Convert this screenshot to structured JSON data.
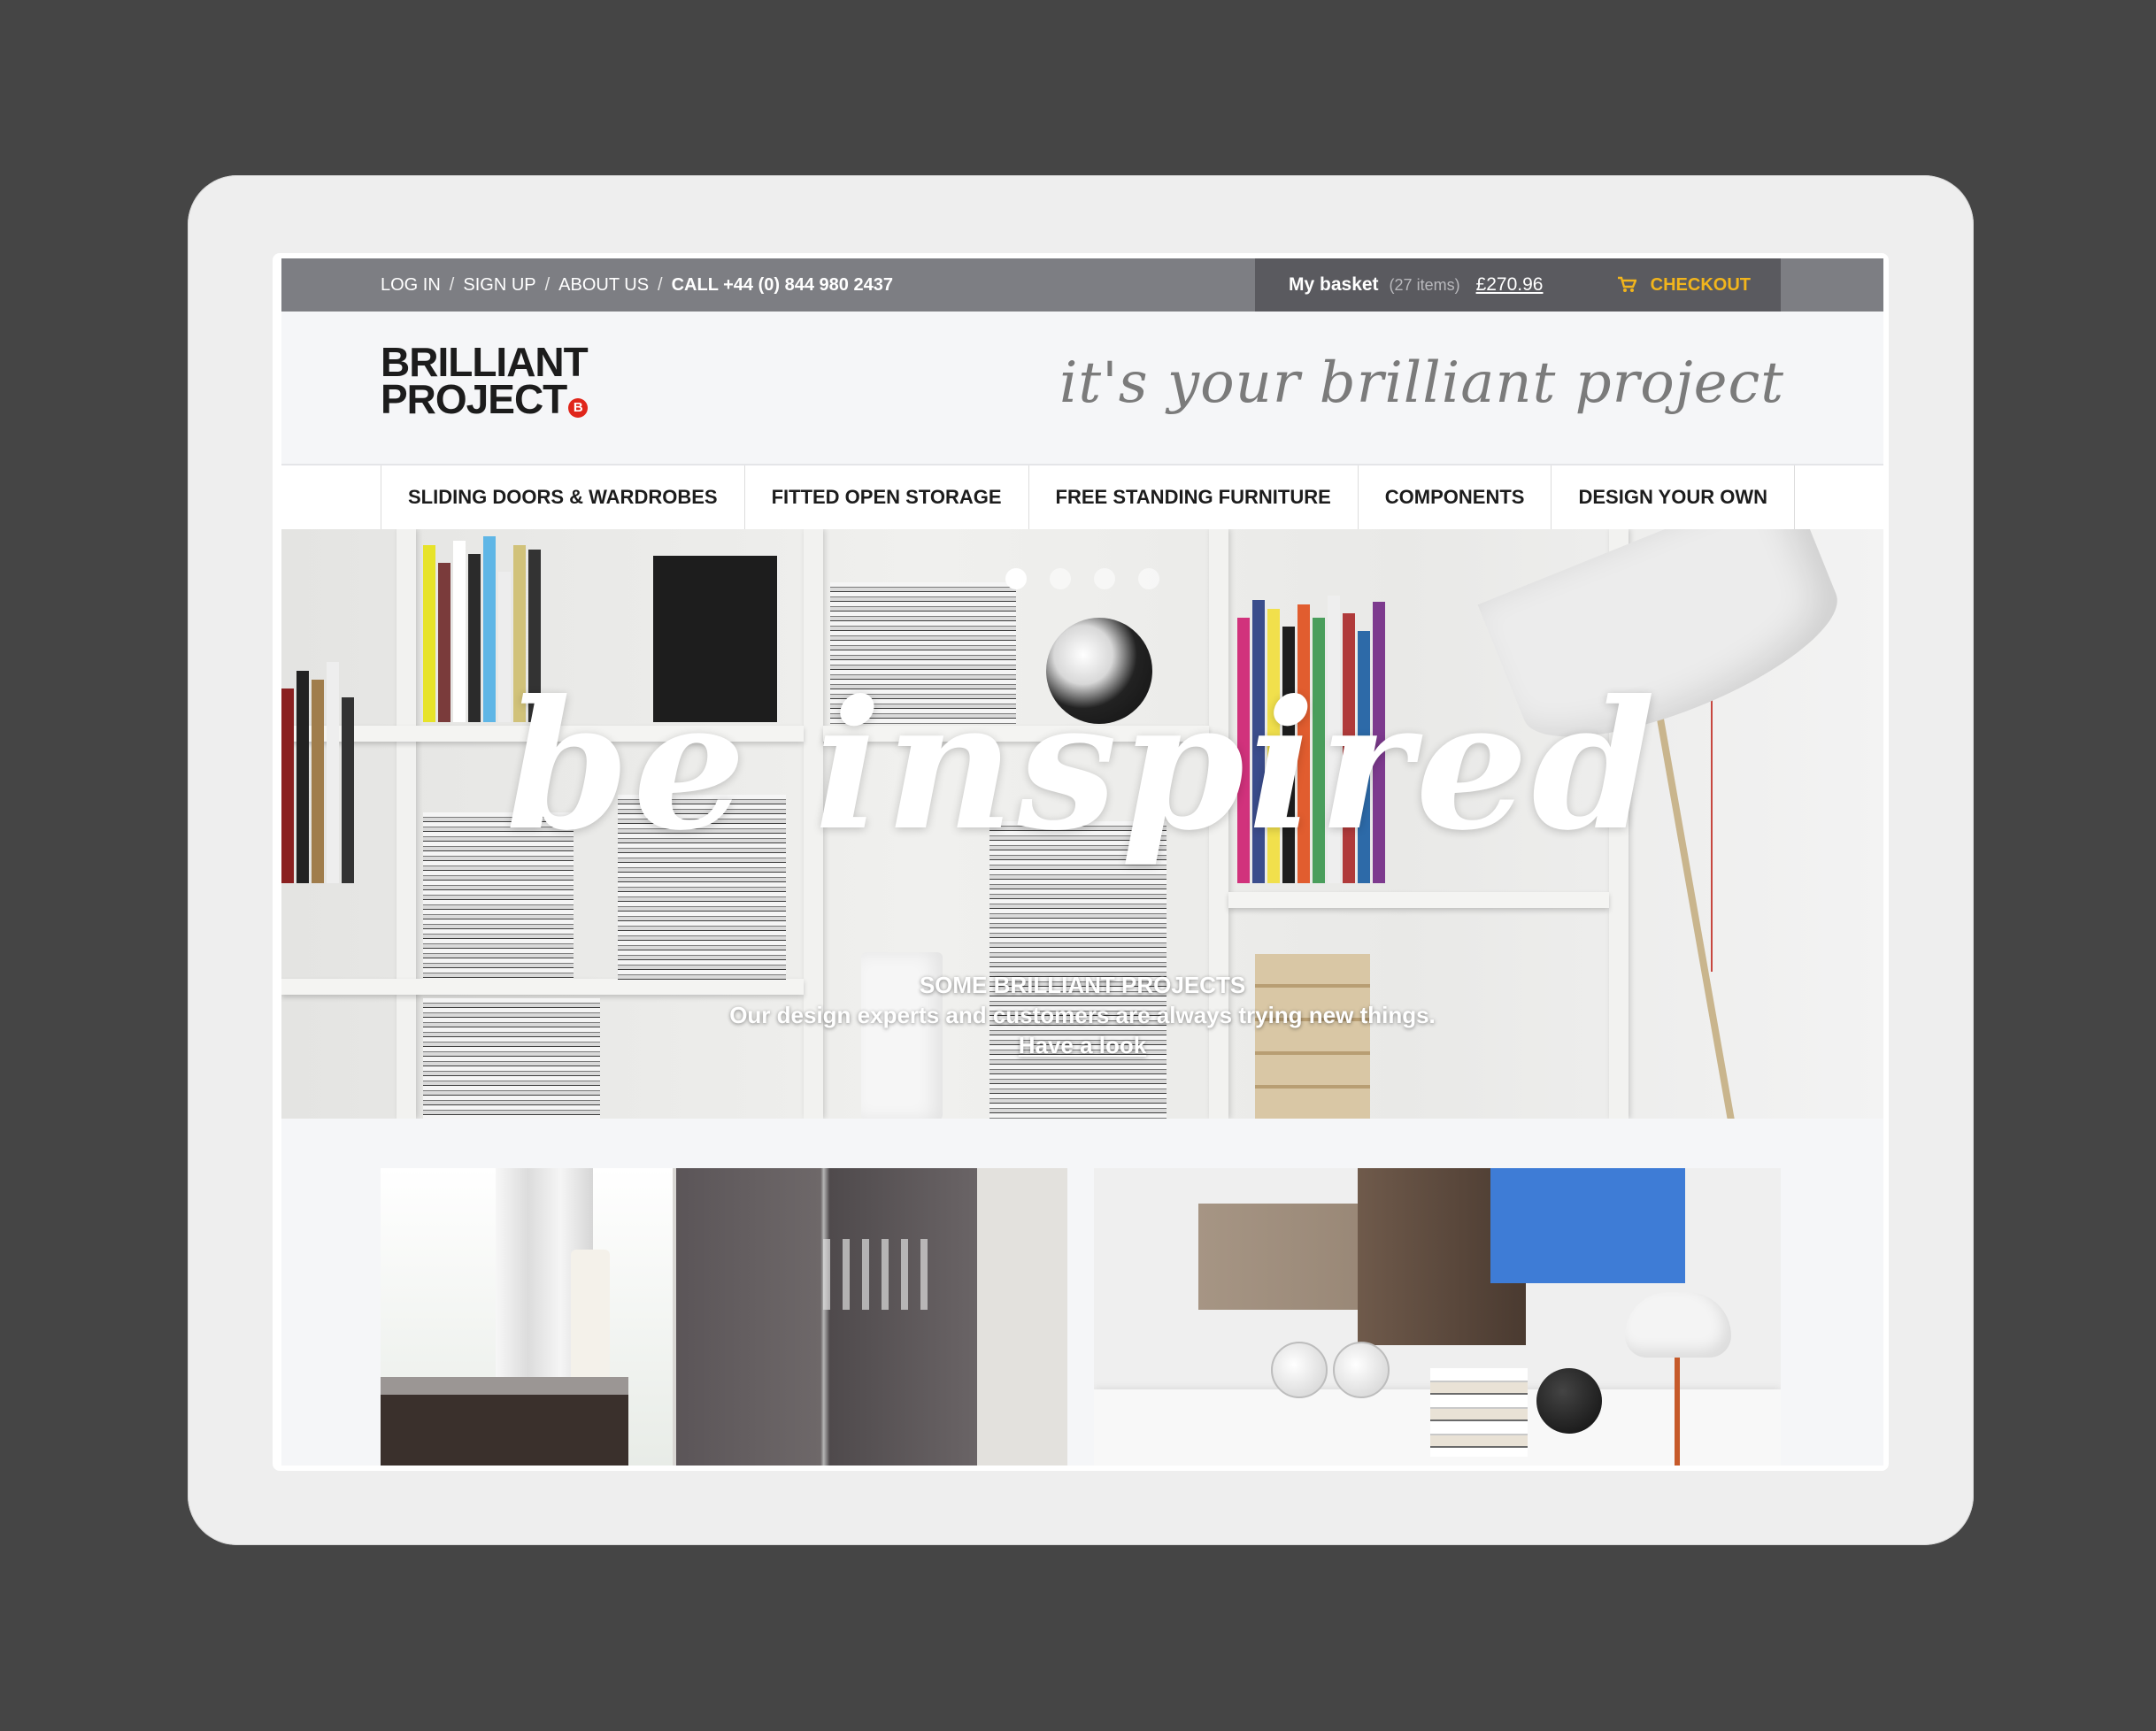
{
  "topbar": {
    "links": [
      "LOG IN",
      "SIGN UP",
      "ABOUT US"
    ],
    "separator": "/",
    "call": "CALL +44 (0) 844 980 2437"
  },
  "basket": {
    "label": "My basket",
    "items": "(27 items)",
    "price": "£270.96",
    "checkout": "CHECKOUT"
  },
  "header": {
    "logo_line1": "BRILLIANT",
    "logo_line2": "PROJECT",
    "logo_badge": "B",
    "tagline": "it's your brilliant project"
  },
  "nav": {
    "items": [
      "SLIDING DOORS & WARDROBES",
      "FITTED OPEN STORAGE",
      "FREE STANDING FURNITURE",
      "COMPONENTS",
      "DESIGN YOUR OWN"
    ]
  },
  "hero": {
    "script": "be inspired",
    "heading": "SOME BRILLIANT PROJECTS",
    "subtext": "Our design experts and customers are always trying new things.",
    "link": "Have a look",
    "slides": 4,
    "active_slide": 1
  },
  "colors": {
    "page_bg": "#454545",
    "topbar": "#7d7e83",
    "basket_bg": "#5a5a5f",
    "checkout": "#f2b51c",
    "logo_badge": "#e0261b"
  }
}
